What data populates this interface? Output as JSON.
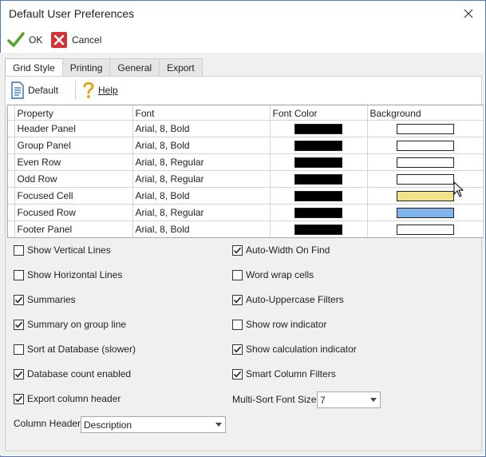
{
  "window": {
    "title": "Default User Preferences"
  },
  "toolbar": {
    "ok_label": "OK",
    "cancel_label": "Cancel"
  },
  "tabs": [
    {
      "label": "Grid Style",
      "active": true
    },
    {
      "label": "Printing",
      "active": false
    },
    {
      "label": "General",
      "active": false
    },
    {
      "label": "Export",
      "active": false
    }
  ],
  "panel_toolbar": {
    "default_label": "Default",
    "help_label": "Help"
  },
  "grid": {
    "columns": [
      "Property",
      "Font",
      "Font Color",
      "Background"
    ],
    "rows": [
      {
        "property": "Header Panel",
        "font": "Arial, 8, Bold",
        "font_color": "#000000",
        "background": "#ffffff"
      },
      {
        "property": "Group Panel",
        "font": "Arial, 8, Bold",
        "font_color": "#000000",
        "background": "#ffffff"
      },
      {
        "property": "Even Row",
        "font": "Arial, 8, Regular",
        "font_color": "#000000",
        "background": "#ffffff"
      },
      {
        "property": "Odd Row",
        "font": "Arial, 8, Regular",
        "font_color": "#000000",
        "background": "#ffffff"
      },
      {
        "property": "Focused Cell",
        "font": "Arial, 8, Bold",
        "font_color": "#000000",
        "background": "#f1e389"
      },
      {
        "property": "Focused Row",
        "font": "Arial, 8, Regular",
        "font_color": "#000000",
        "background": "#7fb5ea"
      },
      {
        "property": "Footer Panel",
        "font": "Arial, 8, Bold",
        "font_color": "#000000",
        "background": "#ffffff"
      }
    ]
  },
  "options_left": [
    {
      "label": "Show Vertical Lines",
      "checked": false
    },
    {
      "label": "Show Horizontal Lines",
      "checked": false
    },
    {
      "label": "Summaries",
      "checked": true
    },
    {
      "label": "Summary on group line",
      "checked": true
    },
    {
      "label": "Sort at Database (slower)",
      "checked": false
    },
    {
      "label": "Database count enabled",
      "checked": true
    },
    {
      "label": "Export column header",
      "checked": true
    }
  ],
  "options_right": [
    {
      "label": "Auto-Width On Find",
      "checked": true
    },
    {
      "label": "Word wrap cells",
      "checked": false
    },
    {
      "label": "Auto-Uppercase Filters",
      "checked": true
    },
    {
      "label": "Show row indicator",
      "checked": false
    },
    {
      "label": "Show calculation indicator",
      "checked": true
    },
    {
      "label": "Smart Column Filters",
      "checked": true
    }
  ],
  "multi_sort": {
    "label": "Multi-Sort Font Size",
    "value": "7"
  },
  "column_header": {
    "label": "Column Header",
    "value": "Description"
  },
  "colors": {
    "window_border": "#4a78c2",
    "ok_green": "#5aa02c",
    "cancel_red": "#d13438"
  }
}
